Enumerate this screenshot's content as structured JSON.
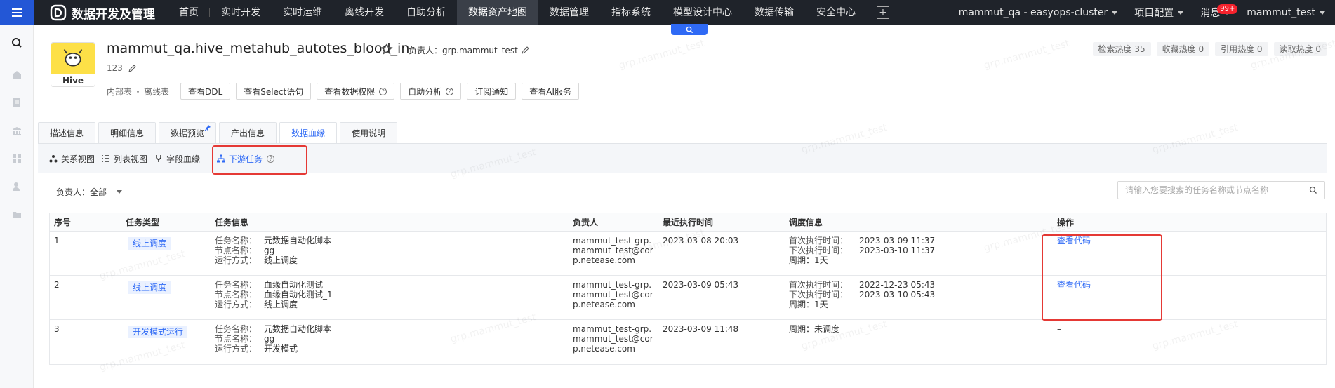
{
  "topnav": {
    "app_title": "数据开发及管理",
    "items": [
      "首页",
      "实时开发",
      "实时运维",
      "离线开发",
      "自助分析",
      "数据资产地图",
      "数据管理",
      "指标系统",
      "模型设计中心",
      "数据传输",
      "安全中心"
    ],
    "active_index": 5,
    "cluster": "mammut_qa - easyops-cluster",
    "project_config": "项目配置",
    "messages": "消息",
    "message_badge": "99+",
    "user": "mammut_test"
  },
  "header": {
    "logo_label": "Hive",
    "table_name": "mammut_qa.hive_metahub_autotes_blood_in",
    "owner_label": "负责人：",
    "owner": "grp.mammut_test",
    "description": "123",
    "tag_internal": "内部表",
    "tag_offline": "离线表",
    "buttons": [
      "查看DDL",
      "查看Select语句",
      "查看数据权限",
      "自助分析",
      "订阅通知",
      "查看AI服务"
    ],
    "stats": [
      "检索热度 35",
      "收藏热度 0",
      "引用热度 0",
      "读取热度 0"
    ]
  },
  "tabs": [
    "描述信息",
    "明细信息",
    "数据预览",
    "产出信息",
    "数据血缘",
    "使用说明"
  ],
  "active_tab": 4,
  "subviews": [
    "关系视图",
    "列表视图",
    "字段血缘",
    "下游任务"
  ],
  "filter": {
    "label": "负责人：",
    "value": "全部"
  },
  "search": {
    "placeholder": "请输入您要搜索的任务名称或节点名称"
  },
  "table": {
    "headers": [
      "序号",
      "任务类型",
      "任务信息",
      "负责人",
      "最近执行时间",
      "调度信息",
      "操作"
    ],
    "labels": {
      "task_name": "任务名称：",
      "node_name": "节点名称：",
      "run_mode": "运行方式：",
      "first_exec": "首次执行时间：",
      "next_exec": "下次执行时间：",
      "period": "周期："
    },
    "rows": [
      {
        "index": "1",
        "type": "线上调度",
        "task_name": "元数据自动化脚本",
        "node_name": "gg",
        "run_mode": "线上调度",
        "owner": "mammut_test-grp.mammut_test@corp.netease.com",
        "last_exec": "2023-03-08 20:03",
        "first_exec": "2023-03-09 11:37",
        "next_exec": "2023-03-10 11:37",
        "period": "1天",
        "action": "查看代码"
      },
      {
        "index": "2",
        "type": "线上调度",
        "task_name": "血缘自动化测试",
        "node_name": "血缘自动化测试_1",
        "run_mode": "线上调度",
        "owner": "mammut_test-grp.mammut_test@corp.netease.com",
        "last_exec": "2023-03-09 05:43",
        "first_exec": "2022-12-23 05:43",
        "next_exec": "2023-03-10 05:43",
        "period": "1天",
        "action": "查看代码"
      },
      {
        "index": "3",
        "type": "开发模式运行",
        "task_name": "元数据自动化脚本",
        "node_name": "gg",
        "run_mode": "开发模式",
        "owner": "mammut_test-grp.mammut_test@corp.netease.com",
        "last_exec": "2023-03-09 11:48",
        "period": "未调度",
        "action": "–"
      }
    ]
  },
  "watermark": "grp.mammut_test",
  "colors": {
    "accent": "#2f6af5",
    "highlight": "#e53935",
    "topbar": "#1f232a"
  }
}
